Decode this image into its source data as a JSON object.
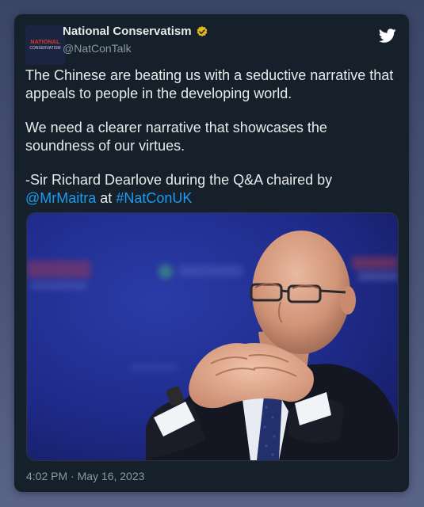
{
  "account": {
    "display_name": "National Conservatism",
    "handle": "@NatConTalk",
    "avatar_text_1": "NATIONAL",
    "avatar_text_2": "CONSERVATISM"
  },
  "tweet": {
    "para1": "The Chinese are beating us with a seductive narrative that appeals to people in the developing world.",
    "para2": "We need a clearer narrative that showcases the soundness of our virtues.",
    "para3_prefix": "-Sir Richard Dearlove during the Q&A chaired by",
    "mention": "@MrMaitra",
    "at_word": "at",
    "hashtag": "#NatConUK"
  },
  "timestamp": "4:02 PM · May 16, 2023",
  "colors": {
    "card_bg": "#15202b",
    "link": "#1d9bf0",
    "verified_badge": "#e2b719",
    "twitter_logo": "#ffffff"
  },
  "icons": {
    "verified": "verified-badge-icon",
    "brand": "twitter-bird-icon"
  }
}
